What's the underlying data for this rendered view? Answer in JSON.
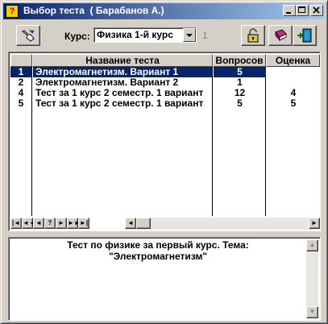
{
  "window": {
    "title": "Выбор теста  ( Барабанов А.)",
    "app_icon_glyph": "?"
  },
  "toolbar": {
    "course_label": "Курс:",
    "course_value": "Физика 1-й курс",
    "course_number": "1"
  },
  "grid": {
    "columns": [
      "Название теста",
      "Вопросов",
      "Оценка"
    ],
    "rows": [
      {
        "num": "1",
        "name": "Электромагнетизм. Вариант 1",
        "questions": "5",
        "grade": "",
        "selected": true
      },
      {
        "num": "2",
        "name": "Электромагнетизм. Вариант 2",
        "questions": "1",
        "grade": ""
      },
      {
        "num": "4",
        "name": "Тест за 1 курс 2 семестр. 1 вариант",
        "questions": "12",
        "grade": "4"
      },
      {
        "num": "5",
        "name": "Тест за 1 курс 2 семестр. 1 вариант",
        "questions": "5",
        "grade": "5"
      }
    ]
  },
  "navigator": [
    "|◄",
    "◄◄",
    "◄",
    "?",
    "►",
    "►►",
    "►|"
  ],
  "description": {
    "line1": "Тест по физике за первый курс. Тема:",
    "line2": "\"Электромагнетизм\""
  },
  "colors": {
    "selection": "#0a246a",
    "face": "#d4d0c8"
  }
}
